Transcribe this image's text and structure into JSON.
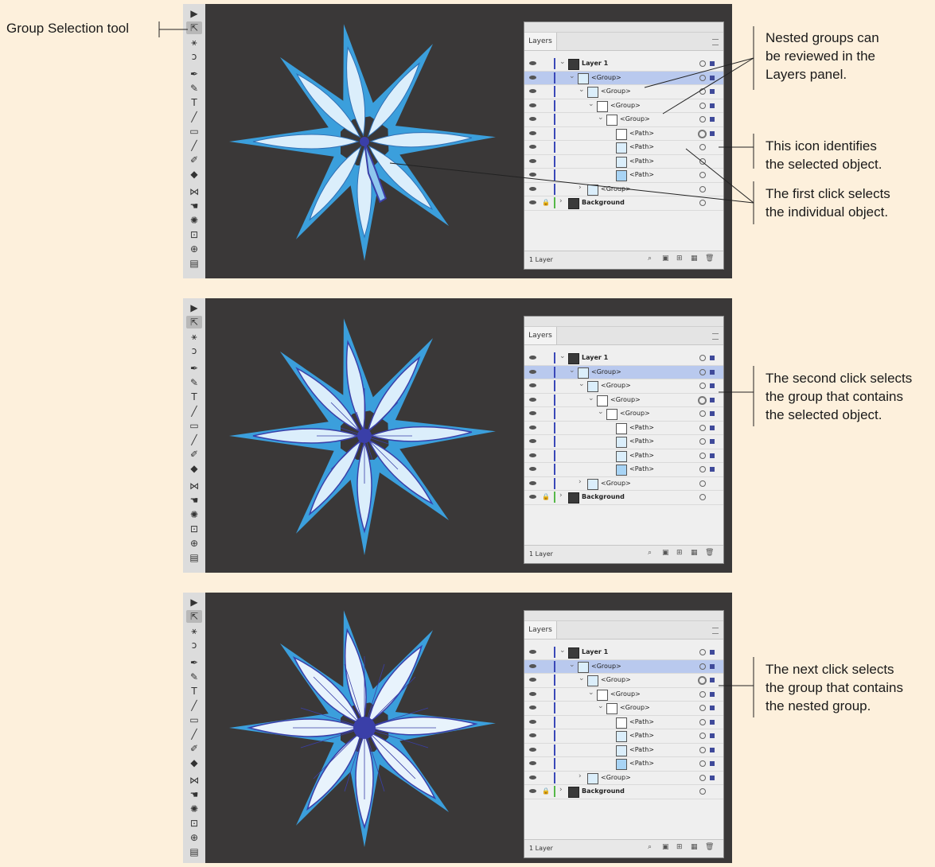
{
  "annotations": {
    "tool_label": "Group Selection tool",
    "nested_groups": "Nested groups can\nbe reviewed in the\nLayers panel.",
    "icon_identifies": "This icon identifies\nthe selected object.",
    "first_click": "The first click selects\nthe individual object.",
    "second_click": "The second click selects\nthe group that contains\nthe selected object.",
    "next_click": "The next click selects\nthe group that contains\nthe nested group."
  },
  "layers_panel": {
    "tab": "Layers",
    "layer_count": "1 Layer",
    "rows": {
      "layer1": "Layer 1",
      "group": "<Group>",
      "path": "<Path>",
      "background": "Background"
    }
  },
  "colors": {
    "page_bg": "#fdf0dc",
    "canvas_bg": "#3a3838",
    "selection_row": "#b9c9ee",
    "star_light": "#dbeefb",
    "star_mid": "#3b9fdc",
    "selection_blue": "#3a3fa8"
  },
  "icons": [
    "selection-arrow-icon",
    "group-selection-icon",
    "magic-wand-icon",
    "lasso-icon",
    "pen-icon",
    "curvature-icon",
    "type-icon",
    "line-icon",
    "rectangle-icon",
    "paintbrush-icon",
    "shaper-icon",
    "eraser-icon",
    "reflect-icon",
    "warp-icon",
    "symbol-sprayer-icon",
    "artboard-icon",
    "zoom-icon",
    "gradient-icon"
  ]
}
